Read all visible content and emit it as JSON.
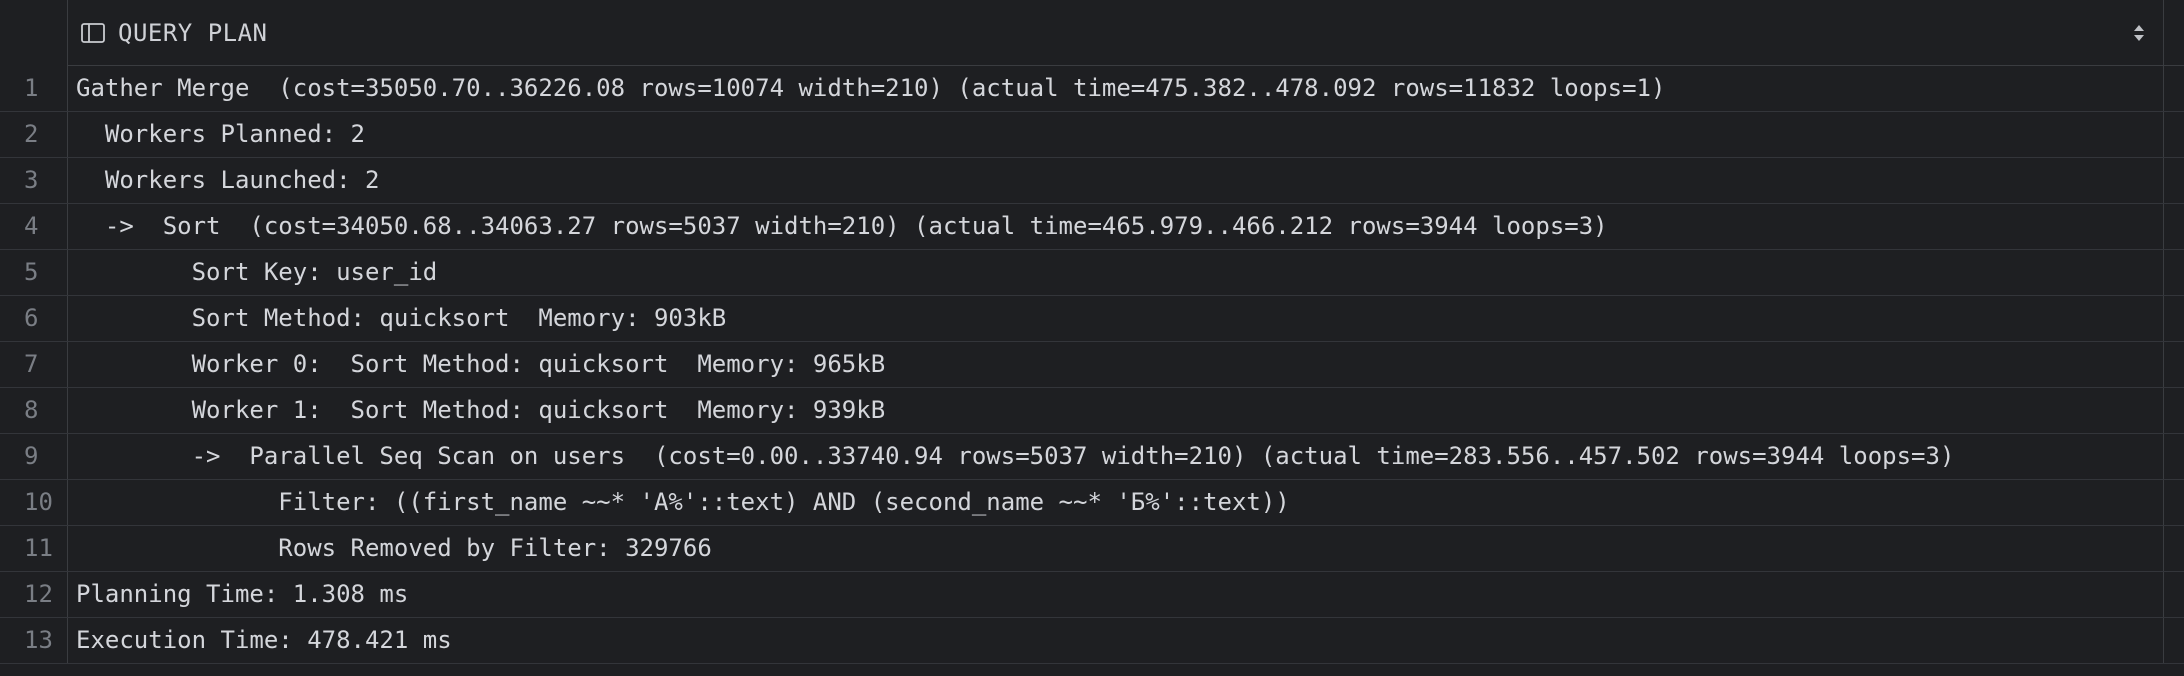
{
  "header": {
    "column_title": "QUERY PLAN",
    "column_icon": "table-layout-icon",
    "sort_icon": "sort-arrows-icon"
  },
  "rows": [
    {
      "num": "1",
      "text": "Gather Merge  (cost=35050.70..36226.08 rows=10074 width=210) (actual time=475.382..478.092 rows=11832 loops=1)"
    },
    {
      "num": "2",
      "text": "  Workers Planned: 2"
    },
    {
      "num": "3",
      "text": "  Workers Launched: 2"
    },
    {
      "num": "4",
      "text": "  ->  Sort  (cost=34050.68..34063.27 rows=5037 width=210) (actual time=465.979..466.212 rows=3944 loops=3)"
    },
    {
      "num": "5",
      "text": "        Sort Key: user_id"
    },
    {
      "num": "6",
      "text": "        Sort Method: quicksort  Memory: 903kB"
    },
    {
      "num": "7",
      "text": "        Worker 0:  Sort Method: quicksort  Memory: 965kB"
    },
    {
      "num": "8",
      "text": "        Worker 1:  Sort Method: quicksort  Memory: 939kB"
    },
    {
      "num": "9",
      "text": "        ->  Parallel Seq Scan on users  (cost=0.00..33740.94 rows=5037 width=210) (actual time=283.556..457.502 rows=3944 loops=3)"
    },
    {
      "num": "10",
      "text": "              Filter: ((first_name ~~* 'А%'::text) AND (second_name ~~* 'Б%'::text))"
    },
    {
      "num": "11",
      "text": "              Rows Removed by Filter: 329766"
    },
    {
      "num": "12",
      "text": "Planning Time: 1.308 ms"
    },
    {
      "num": "13",
      "text": "Execution Time: 478.421 ms"
    }
  ],
  "colors": {
    "background": "#1e1f22",
    "text": "#d4d6db",
    "line_number": "#7a7e85",
    "grid_line": "#3a3c40"
  }
}
